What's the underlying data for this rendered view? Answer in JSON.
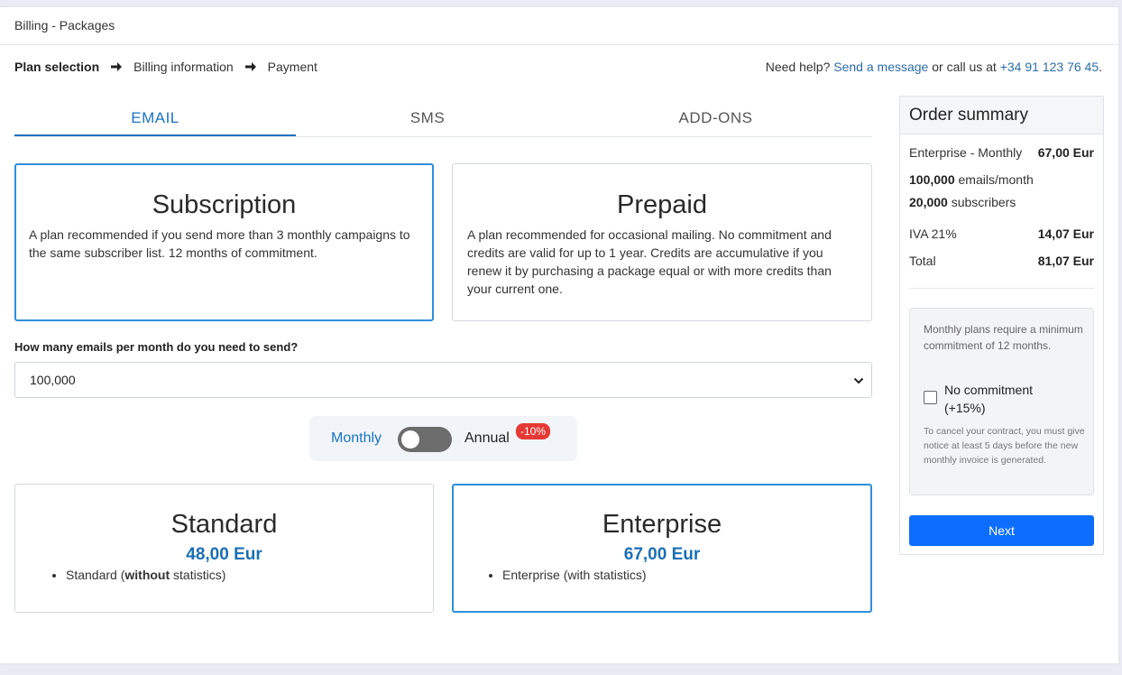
{
  "window": {
    "title": "Billing - Packages"
  },
  "steps": [
    {
      "label": "Plan selection",
      "active": true
    },
    {
      "label": "Billing information",
      "active": false
    },
    {
      "label": "Payment",
      "active": false
    }
  ],
  "help": {
    "prefix": "Need help?",
    "message_link": "Send a message",
    "middle": "or call us at",
    "phone": "+34 91 123 76 45",
    "suffix": "."
  },
  "tabs": [
    {
      "label": "EMAIL",
      "active": true
    },
    {
      "label": "SMS",
      "active": false
    },
    {
      "label": "ADD-ONS",
      "active": false
    }
  ],
  "plan_types": {
    "subscription": {
      "title": "Subscription",
      "description": "A plan recommended if you send more than 3 monthly campaigns to the same subscriber list. 12 months of commitment.",
      "selected": true
    },
    "prepaid": {
      "title": "Prepaid",
      "description": "A plan recommended for occasional mailing. No commitment and credits are valid for up to 1 year. Credits are accumulative if you renew it by purchasing a package equal or with more credits than your current one.",
      "selected": false
    }
  },
  "emails_question": {
    "label": "How many emails per month do you need to send?",
    "value": "100,000"
  },
  "billing_toggle": {
    "monthly_label": "Monthly",
    "annual_label": "Annual",
    "discount_badge": "-10%",
    "selected": "Monthly"
  },
  "packages": {
    "standard": {
      "name": "Standard",
      "price": "48,00 Eur",
      "feature_prefix": "Standard (",
      "feature_bold": "without",
      "feature_suffix": " statistics)",
      "selected": false
    },
    "enterprise": {
      "name": "Enterprise",
      "price": "67,00 Eur",
      "feature": "Enterprise (with statistics)",
      "selected": true
    }
  },
  "summary": {
    "title": "Order summary",
    "plan_label": "Enterprise - Monthly",
    "plan_price": "67,00 Eur",
    "emails_value": "100,000",
    "emails_unit": "emails/month",
    "subscribers_value": "20,000",
    "subscribers_unit": "subscribers",
    "tax_label": "IVA 21%",
    "tax_value": "14,07 Eur",
    "total_label": "Total",
    "total_value": "81,07 Eur",
    "commitment_note": "Monthly plans require a minimum commitment of 12 months.",
    "no_commitment_label": "No commitment (+15%)",
    "no_commitment_checked": false,
    "cancel_note": "To cancel your contract, you must give notice at least 5 days before the new monthly invoice is generated.",
    "next_button": "Next"
  },
  "colors": {
    "accent": "#1a73c1",
    "selected_border": "#2e8fdc",
    "primary_button": "#0d6efd",
    "badge": "#e53935"
  }
}
